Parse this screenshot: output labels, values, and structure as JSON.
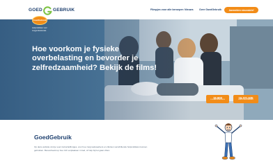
{
  "header": {
    "logo_left": "GOED",
    "logo_right": "GEBRUIK",
    "nav": [
      "Filmpjes voor alle beroepen",
      "Nieuws",
      "Over GoedGebruik"
    ],
    "cta_label": "Aanmelden nieuwsbrief"
  },
  "hero": {
    "badge_label": "GoedGebruik",
    "badge_sub_line1": "Hulpmiddelen voor",
    "badge_sub_line2": "zorgprofessionals",
    "title": "Hoe voorkom je fysieke overbelasting en bevorder je zelfredzaamheid? Bekijk de films!",
    "stats": [
      {
        "value": "19.900",
        "label": "ZORGMEDEWERKERS"
      },
      {
        "value": "16.221.635",
        "label": "KEER FILMS BEKEKEN"
      }
    ]
  },
  "content": {
    "title": "GoedGebruik",
    "text": "Op deze website vind je veel instructiefilmpjes, voor hoe zorgmedewerkers en cliënten verschillende hulpmiddelen kunnen gebruiken. Bevoorbeeld op hoe zich verplaatsen in bed, of hulp bij het gaan zitten."
  },
  "colors": {
    "navy": "#1d3f6e",
    "orange": "#f28c18",
    "green": "#7cc242"
  }
}
